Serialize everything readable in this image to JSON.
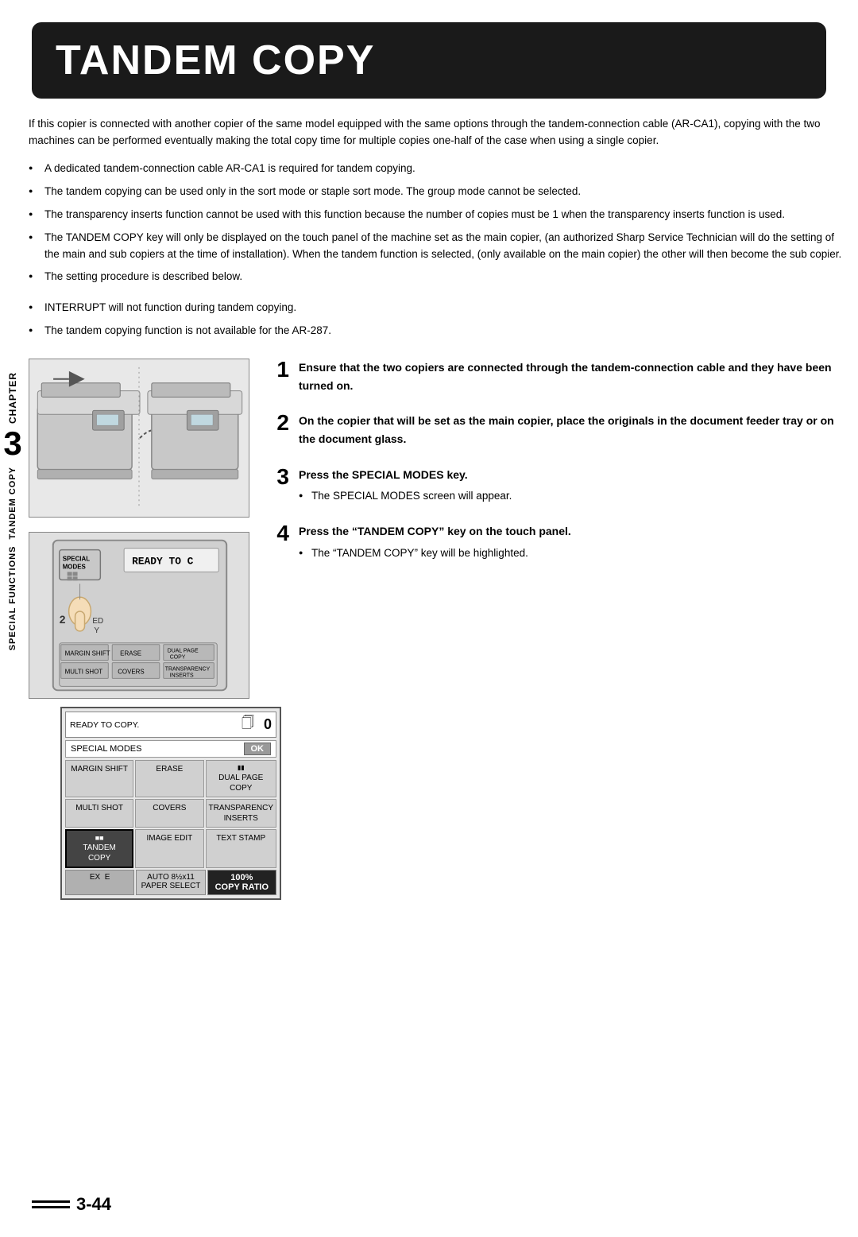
{
  "title": "TANDEM COPY",
  "chapter": {
    "label": "CHAPTER",
    "number": "3",
    "sub": "SPECIAL FUNCTIONS   Tandem copy"
  },
  "intro": "If this copier is connected with another copier of the same model equipped with the same options through the tandem-connection cable (AR-CA1), copying with the two machines can be performed eventually making the total copy time for multiple copies one-half of the case when using a single copier.",
  "bullets": [
    "A dedicated tandem-connection cable AR-CA1 is required for tandem copying.",
    "The tandem copying can be used only in the sort mode or staple sort mode. The group mode cannot be selected.",
    "The transparency inserts function cannot be used with this function because the number of copies must be 1 when the transparency inserts function is used.",
    "The TANDEM COPY key will only be displayed on the touch panel of the machine set as the main copier, (an authorized Sharp Service Technician will do the setting of the main and sub copiers at the time of installation). When the tandem function is selected, (only available on the main copier) the other will then become the sub copier.",
    "The setting procedure is described below."
  ],
  "extra_bullets": [
    "INTERRUPT will not function during tandem copying.",
    "The tandem  copying function is not available for the AR-287."
  ],
  "steps": [
    {
      "num": "1",
      "text": "Ensure that the two copiers are connected through the tandem-connection cable and they have been turned on."
    },
    {
      "num": "2",
      "text": "On the copier that will be set as the main copier, place the originals in the document feeder tray or on the document glass."
    },
    {
      "num": "3",
      "header": "Press the SPECIAL MODES key.",
      "note": "The SPECIAL MODES screen will appear."
    },
    {
      "num": "4",
      "header": "Press the “TANDEM COPY” key on the touch panel.",
      "note": "The “TANDEM COPY” key will be highlighted."
    }
  ],
  "panel": {
    "ready_label": "READY TO COPY.",
    "ready_num": "0",
    "special_modes_label": "SPECIAL MODES",
    "ok_label": "OK",
    "buttons": [
      {
        "label": "MARGIN SHIFT",
        "type": "normal"
      },
      {
        "label": "ERASE",
        "type": "normal"
      },
      {
        "label": "DUAL PAGE\nCOPY",
        "type": "icon"
      },
      {
        "label": "MULTI SHOT",
        "type": "normal"
      },
      {
        "label": "COVERS",
        "type": "normal"
      },
      {
        "label": "TRANSPARENCY\nINSERTS",
        "type": "normal"
      },
      {
        "label": "TANDEM\nCOPY",
        "type": "highlight"
      },
      {
        "label": "IMAGE EDIT",
        "type": "normal"
      },
      {
        "label": "TEXT STAMP",
        "type": "normal"
      }
    ],
    "bottom": [
      {
        "label": "EX   E",
        "type": "normal"
      },
      {
        "label": "AUTO 8½x11\nPAPER SELECT",
        "type": "paper"
      },
      {
        "label": "100%\nCOPY RATIO",
        "type": "ratio"
      }
    ],
    "screen_text": "READY TO C",
    "special_modes_key": "SPECIAL\nMODES"
  },
  "page_number": "3-44"
}
